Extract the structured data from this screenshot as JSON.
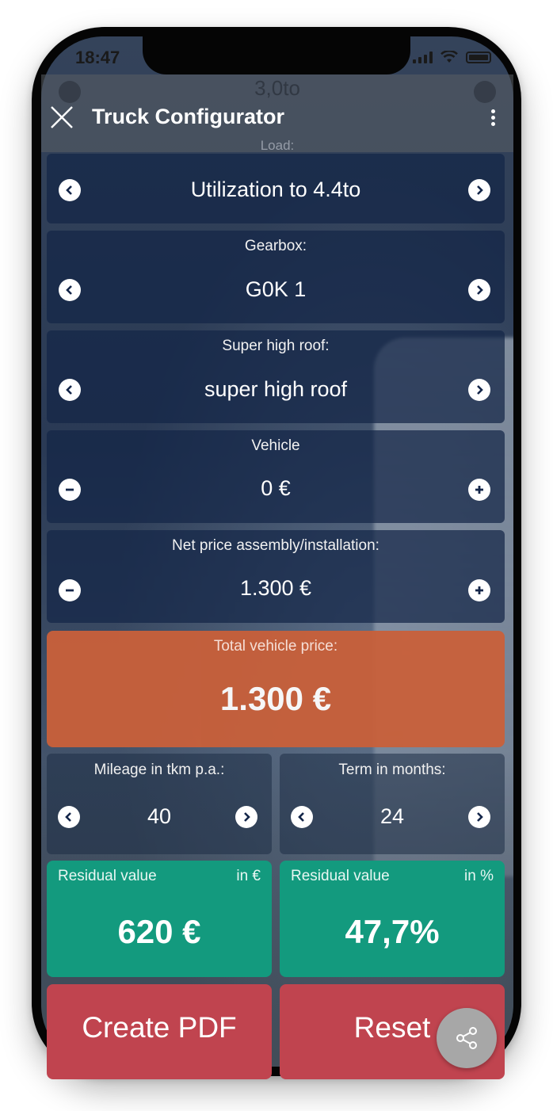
{
  "status": {
    "time": "18:47"
  },
  "header": {
    "ghost_value": "3,0to",
    "ghost_label": "Load:",
    "title": "Truck Configurator"
  },
  "rows": [
    {
      "label": "",
      "value": "Utilization to 4.4to",
      "controls": "arrows"
    },
    {
      "label": "Gearbox:",
      "value": "G0K 1",
      "controls": "arrows"
    },
    {
      "label": "Super high roof:",
      "value": "super high roof",
      "controls": "arrows"
    },
    {
      "label": "Vehicle",
      "value": "0 €",
      "controls": "plus-minus"
    },
    {
      "label": "Net price assembly/installation:",
      "value": "1.300 €",
      "controls": "plus-minus"
    }
  ],
  "total": {
    "label": "Total vehicle price:",
    "value": "1.300 €"
  },
  "mileage": {
    "label": "Mileage in tkm p.a.:",
    "value": "40"
  },
  "term": {
    "label": "Term in months:",
    "value": "24"
  },
  "residual_eur": {
    "label": "Residual value",
    "unit": "in €",
    "value": "620 €"
  },
  "residual_pct": {
    "label": "Residual value",
    "unit": "in %",
    "value": "47,7%"
  },
  "buttons": {
    "pdf": "Create PDF",
    "reset": "Reset"
  },
  "colors": {
    "orange": "#c9603a",
    "green": "#139a7e",
    "red": "#c0444f",
    "card": "#14264a"
  },
  "icons": {
    "close": "close-icon",
    "menu": "more-vertical-icon",
    "prev": "chevron-left-icon",
    "next": "chevron-right-icon",
    "minus": "minus-icon",
    "plus": "plus-icon",
    "share": "share-icon"
  }
}
